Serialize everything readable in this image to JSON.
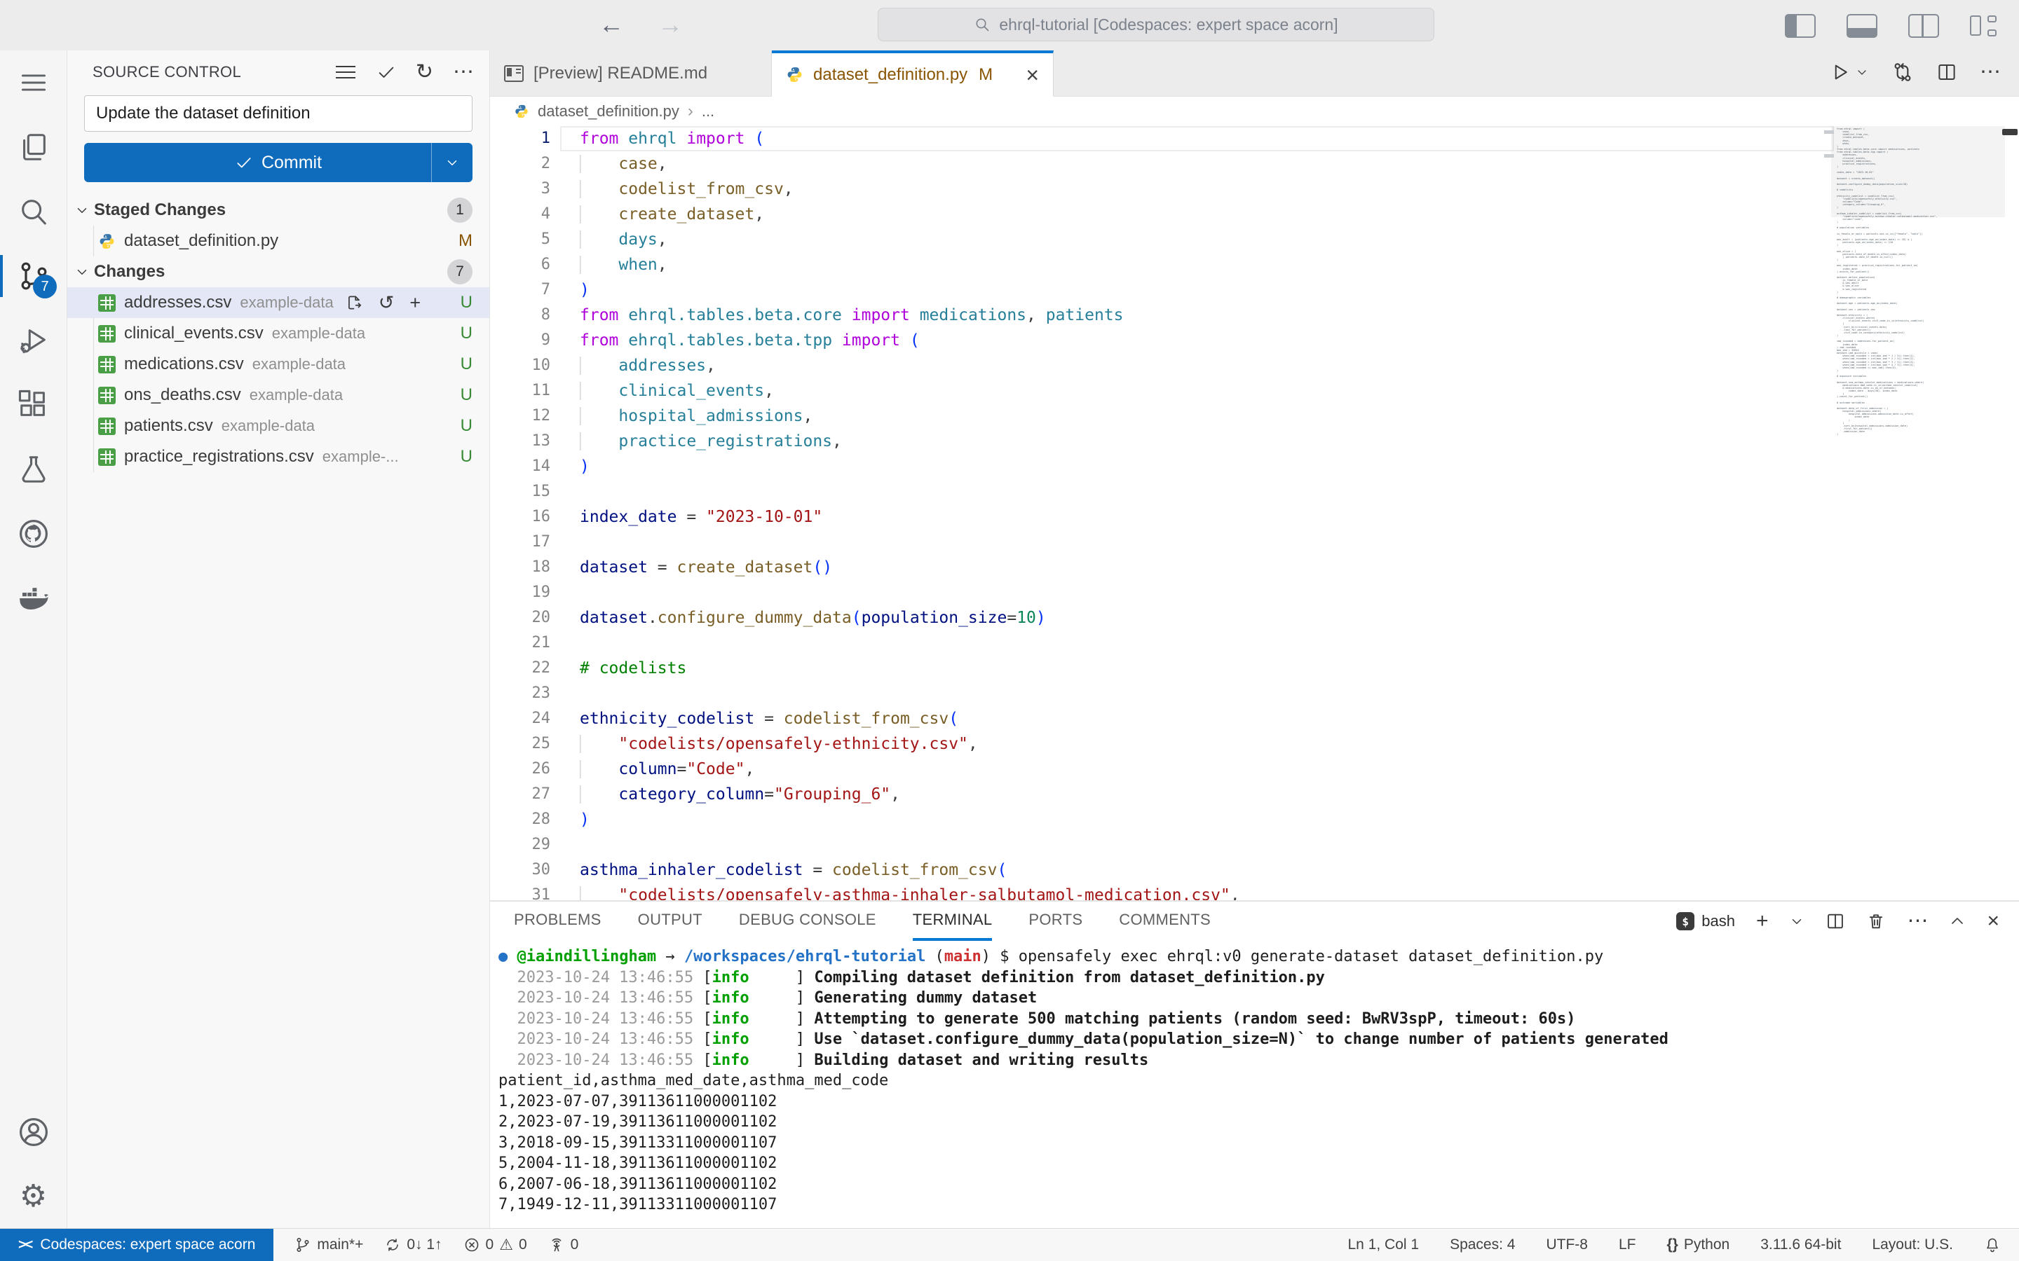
{
  "title_bar": {
    "search_text": "ehrql-tutorial [Codespaces: expert space acorn]"
  },
  "activity_bar": {
    "scm_badge": "7"
  },
  "sidebar": {
    "title": "SOURCE CONTROL",
    "commit_message": "Update the dataset definition",
    "commit_label": "Commit",
    "sections": [
      {
        "label": "Staged Changes",
        "badge": "1",
        "items": [
          {
            "name": "dataset_definition.py",
            "folder": "",
            "status": "M",
            "icon": "python",
            "hovered": false
          }
        ]
      },
      {
        "label": "Changes",
        "badge": "7",
        "items": [
          {
            "name": "addresses.csv",
            "folder": "example-data",
            "status": "U",
            "icon": "csv",
            "hovered": true
          },
          {
            "name": "clinical_events.csv",
            "folder": "example-data",
            "status": "U",
            "icon": "csv",
            "hovered": false
          },
          {
            "name": "medications.csv",
            "folder": "example-data",
            "status": "U",
            "icon": "csv",
            "hovered": false
          },
          {
            "name": "ons_deaths.csv",
            "folder": "example-data",
            "status": "U",
            "icon": "csv",
            "hovered": false
          },
          {
            "name": "patients.csv",
            "folder": "example-data",
            "status": "U",
            "icon": "csv",
            "hovered": false
          },
          {
            "name": "practice_registrations.csv",
            "folder": "example-...",
            "status": "U",
            "icon": "csv",
            "hovered": false
          }
        ]
      }
    ]
  },
  "editor": {
    "tabs": [
      {
        "label": "[Preview] README.md",
        "icon": "preview",
        "active": false,
        "badge": ""
      },
      {
        "label": "dataset_definition.py",
        "icon": "python",
        "active": true,
        "badge": "M"
      }
    ],
    "breadcrumb_file": "dataset_definition.py",
    "breadcrumb_more": "...",
    "code_lines": [
      {
        "n": 1,
        "cur": true,
        "t": [
          [
            "from",
            "k"
          ],
          [
            " ",
            "d"
          ],
          [
            "ehrql",
            "m"
          ],
          [
            " ",
            "d"
          ],
          [
            "import",
            "k"
          ],
          [
            " ",
            "d"
          ],
          [
            "(",
            "p"
          ]
        ]
      },
      {
        "n": 2,
        "t": [
          [
            "    ",
            "g"
          ],
          [
            "case",
            "f"
          ],
          [
            ",",
            "d"
          ]
        ]
      },
      {
        "n": 3,
        "t": [
          [
            "    ",
            "g"
          ],
          [
            "codelist_from_csv",
            "f"
          ],
          [
            ",",
            "d"
          ]
        ]
      },
      {
        "n": 4,
        "t": [
          [
            "    ",
            "g"
          ],
          [
            "create_dataset",
            "f"
          ],
          [
            ",",
            "d"
          ]
        ]
      },
      {
        "n": 5,
        "t": [
          [
            "    ",
            "g"
          ],
          [
            "days",
            "m"
          ],
          [
            ",",
            "d"
          ]
        ]
      },
      {
        "n": 6,
        "t": [
          [
            "    ",
            "g"
          ],
          [
            "when",
            "m"
          ],
          [
            ",",
            "d"
          ]
        ]
      },
      {
        "n": 7,
        "t": [
          [
            ")",
            "p"
          ]
        ]
      },
      {
        "n": 8,
        "t": [
          [
            "from",
            "k"
          ],
          [
            " ",
            "d"
          ],
          [
            "ehrql.tables.beta.core",
            "m"
          ],
          [
            " ",
            "d"
          ],
          [
            "import",
            "k"
          ],
          [
            " ",
            "d"
          ],
          [
            "medications",
            "m"
          ],
          [
            ", ",
            "d"
          ],
          [
            "patients",
            "m"
          ]
        ]
      },
      {
        "n": 9,
        "t": [
          [
            "from",
            "k"
          ],
          [
            " ",
            "d"
          ],
          [
            "ehrql.tables.beta.tpp",
            "m"
          ],
          [
            " ",
            "d"
          ],
          [
            "import",
            "k"
          ],
          [
            " ",
            "d"
          ],
          [
            "(",
            "p"
          ]
        ]
      },
      {
        "n": 10,
        "t": [
          [
            "    ",
            "g"
          ],
          [
            "addresses",
            "m"
          ],
          [
            ",",
            "d"
          ]
        ]
      },
      {
        "n": 11,
        "t": [
          [
            "    ",
            "g"
          ],
          [
            "clinical_events",
            "m"
          ],
          [
            ",",
            "d"
          ]
        ]
      },
      {
        "n": 12,
        "t": [
          [
            "    ",
            "g"
          ],
          [
            "hospital_admissions",
            "m"
          ],
          [
            ",",
            "d"
          ]
        ]
      },
      {
        "n": 13,
        "t": [
          [
            "    ",
            "g"
          ],
          [
            "practice_registrations",
            "m"
          ],
          [
            ",",
            "d"
          ]
        ]
      },
      {
        "n": 14,
        "t": [
          [
            ")",
            "p"
          ]
        ]
      },
      {
        "n": 15,
        "t": []
      },
      {
        "n": 16,
        "t": [
          [
            "index_date",
            "v"
          ],
          [
            " = ",
            "d"
          ],
          [
            "\"2023-10-01\"",
            "s"
          ]
        ]
      },
      {
        "n": 17,
        "t": []
      },
      {
        "n": 18,
        "t": [
          [
            "dataset",
            "v"
          ],
          [
            " = ",
            "d"
          ],
          [
            "create_dataset",
            "f"
          ],
          [
            "()",
            "p"
          ]
        ]
      },
      {
        "n": 19,
        "t": []
      },
      {
        "n": 20,
        "t": [
          [
            "dataset",
            "v"
          ],
          [
            ".",
            "d"
          ],
          [
            "configure_dummy_data",
            "f"
          ],
          [
            "(",
            "p"
          ],
          [
            "population_size",
            "v"
          ],
          [
            "=",
            "d"
          ],
          [
            "10",
            "n"
          ],
          [
            ")",
            "p"
          ]
        ]
      },
      {
        "n": 21,
        "t": []
      },
      {
        "n": 22,
        "t": [
          [
            "# codelists",
            "c"
          ]
        ]
      },
      {
        "n": 23,
        "t": []
      },
      {
        "n": 24,
        "t": [
          [
            "ethnicity_codelist",
            "v"
          ],
          [
            " = ",
            "d"
          ],
          [
            "codelist_from_csv",
            "f"
          ],
          [
            "(",
            "p"
          ]
        ]
      },
      {
        "n": 25,
        "t": [
          [
            "    ",
            "g"
          ],
          [
            "\"codelists/opensafely-ethnicity.csv\"",
            "s"
          ],
          [
            ",",
            "d"
          ]
        ]
      },
      {
        "n": 26,
        "t": [
          [
            "    ",
            "g"
          ],
          [
            "column",
            "v"
          ],
          [
            "=",
            "d"
          ],
          [
            "\"Code\"",
            "s"
          ],
          [
            ",",
            "d"
          ]
        ]
      },
      {
        "n": 27,
        "t": [
          [
            "    ",
            "g"
          ],
          [
            "category_column",
            "v"
          ],
          [
            "=",
            "d"
          ],
          [
            "\"Grouping_6\"",
            "s"
          ],
          [
            ",",
            "d"
          ]
        ]
      },
      {
        "n": 28,
        "t": [
          [
            ")",
            "p"
          ]
        ]
      },
      {
        "n": 29,
        "t": []
      },
      {
        "n": 30,
        "t": [
          [
            "asthma_inhaler_codelist",
            "v"
          ],
          [
            " = ",
            "d"
          ],
          [
            "codelist_from_csv",
            "f"
          ],
          [
            "(",
            "p"
          ]
        ]
      },
      {
        "n": 31,
        "t": [
          [
            "    ",
            "g"
          ],
          [
            "\"codelists/opensafely-asthma-inhaler-salbutamol-medication.csv\"",
            "s"
          ],
          [
            ",",
            "d"
          ]
        ]
      }
    ],
    "minimap_lines": [
      "from ehrql import (",
      "    case,",
      "    codelist_from_csv,",
      "    create_dataset,",
      "    days,",
      "    when,",
      ")",
      "from ehrql.tables.beta.core import medications, patients",
      "from ehrql.tables.beta.tpp import (",
      "    addresses,",
      "    clinical_events,",
      "    hospital_admissions,",
      "    practice_registrations,",
      ")",
      "",
      "index_date = \"2023-10-01\"",
      "",
      "dataset = create_dataset()",
      "",
      "dataset.configure_dummy_data(population_size=10)",
      "",
      "# codelists",
      "",
      "ethnicity_codelist = codelist_from_csv(",
      "    \"codelists/opensafely-ethnicity.csv\",",
      "    column=\"Code\",",
      "    category_column=\"Grouping_6\",",
      ")",
      "",
      "asthma_inhaler_codelist = codelist_from_csv(",
      "    \"codelists/opensafely-asthma-inhaler-salbutamol-medication.csv\",",
      "    column=\"code\",",
      ")",
      "",
      "# population variables",
      "",
      "is_female_or_male = patients.sex.is_in([\"female\", \"male\"])",
      "",
      "was_adult = (patients.age_on(index_date) >= 18) & (",
      "    patients.age_on(index_date) <= 110",
      ")",
      "",
      "was_alive = (",
      "    patients.date_of_death.is_after(index_date)",
      "    | patients.date_of_death.is_null()",
      ")",
      "",
      "was_registered = practice_registrations.for_patient_on(",
      "    index_date",
      ").exists_for_patient()",
      "",
      "dataset.define_population(",
      "    is_female_or_male",
      "    & was_adult",
      "    & was_alive",
      "    & was_registered",
      ")",
      "",
      "# demographic variables",
      "",
      "dataset.age = patients.age_on(index_date)",
      "",
      "dataset.sex = patients.sex",
      "",
      "dataset.ethnicity = (",
      "    clinical_events.where(",
      "        clinical_events.ctv3_code.is_in(ethnicity_codelist)",
      "    )",
      "    .sort_by(clinical_events.date)",
      "    .last_for_patient()",
      "    .ctv3_code.to_category(ethnicity_codelist)",
      ")",
      "",
      "imd_rounded = addresses.for_patient_on(",
      "    index_date",
      ").imd_rounded",
      "max_imd = 32844",
      "dataset.imd_quintile = case(",
      "    when(imd_rounded < int(max_imd * 1 / 5)).then(1),",
      "    when(imd_rounded < int(max_imd * 2 / 5)).then(2),",
      "    when(imd_rounded < int(max_imd * 3 / 5)).then(3),",
      "    when(imd_rounded < int(max_imd * 4 / 5)).then(4),",
      "    when(imd_rounded <= max_imd).then(5),",
      ")",
      "",
      "# exposure variables",
      "",
      "dataset.num_asthma_inhaler_medications = medications.where(",
      "    medications.dmd_code.is_in(asthma_inhaler_codelist)",
      "    & medications.date.is_on_or_between(",
      "        index_date - days(30), index_date",
      "    )",
      ").count_for_patient()",
      "",
      "# outcome variables",
      "",
      "dataset.date_of_first_admission = (",
      "    hospital_admissions.where(",
      "        hospital_admissions.admission_date.is_after(",
      "            index_date",
      "        )",
      "    )",
      "    .sort_by(hospital_admissions.admission_date)",
      "    .first_for_patient()",
      "    .admission_date",
      ")"
    ]
  },
  "panel": {
    "tabs": [
      {
        "label": "PROBLEMS",
        "active": false
      },
      {
        "label": "OUTPUT",
        "active": false
      },
      {
        "label": "DEBUG CONSOLE",
        "active": false
      },
      {
        "label": "TERMINAL",
        "active": true
      },
      {
        "label": "PORTS",
        "active": false
      },
      {
        "label": "COMMENTS",
        "active": false
      }
    ],
    "shell_label": "bash",
    "terminal_lines": [
      [
        [
          "● ",
          "t-dot"
        ],
        [
          "@iaindillingham",
          "t-g"
        ],
        [
          " → ",
          "t-d"
        ],
        [
          "/workspaces/ehrql-tutorial",
          "t-b"
        ],
        [
          " (",
          "t-d"
        ],
        [
          "main",
          "t-r"
        ],
        [
          ") ",
          "t-d"
        ],
        [
          "$ opensafely exec ehrql:v0 generate-dataset dataset_definition.py",
          "t-d"
        ]
      ],
      [
        [
          "  2023-10-24 13:46:55 ",
          "t-dim"
        ],
        [
          "[",
          "t-d"
        ],
        [
          "info",
          "t-g"
        ],
        [
          "     ] ",
          "t-d"
        ],
        [
          "Compiling dataset definition from dataset_definition.py",
          "t-bold"
        ]
      ],
      [
        [
          "  2023-10-24 13:46:55 ",
          "t-dim"
        ],
        [
          "[",
          "t-d"
        ],
        [
          "info",
          "t-g"
        ],
        [
          "     ] ",
          "t-d"
        ],
        [
          "Generating dummy dataset",
          "t-bold"
        ]
      ],
      [
        [
          "  2023-10-24 13:46:55 ",
          "t-dim"
        ],
        [
          "[",
          "t-d"
        ],
        [
          "info",
          "t-g"
        ],
        [
          "     ] ",
          "t-d"
        ],
        [
          "Attempting to generate 500 matching patients (random seed: BwRV3spP, timeout: 60s)",
          "t-bold"
        ]
      ],
      [
        [
          "  2023-10-24 13:46:55 ",
          "t-dim"
        ],
        [
          "[",
          "t-d"
        ],
        [
          "info",
          "t-g"
        ],
        [
          "     ] ",
          "t-d"
        ],
        [
          "Use `dataset.configure_dummy_data(population_size=N)` to change number of patients generated",
          "t-bold"
        ]
      ],
      [
        [
          "  2023-10-24 13:46:55 ",
          "t-dim"
        ],
        [
          "[",
          "t-d"
        ],
        [
          "info",
          "t-g"
        ],
        [
          "     ] ",
          "t-d"
        ],
        [
          "Building dataset and writing results",
          "t-bold"
        ]
      ],
      [
        [
          "patient_id,asthma_med_date,asthma_med_code",
          "t-d"
        ]
      ],
      [
        [
          "1,2023-07-07,39113611000001102",
          "t-d"
        ]
      ],
      [
        [
          "2,2023-07-19,39113611000001102",
          "t-d"
        ]
      ],
      [
        [
          "3,2018-09-15,39113311000001107",
          "t-d"
        ]
      ],
      [
        [
          "5,2004-11-18,39113611000001102",
          "t-d"
        ]
      ],
      [
        [
          "6,2007-06-18,39113611000001102",
          "t-d"
        ]
      ],
      [
        [
          "7,1949-12-11,39113311000001107",
          "t-d"
        ]
      ]
    ]
  },
  "status_bar": {
    "remote_label": "Codespaces: expert space acorn",
    "branch": "main*+",
    "sync": "0↓ 1↑",
    "errors": "0",
    "warnings": "0",
    "ports": "0",
    "cursor": "Ln 1, Col 1",
    "indent": "Spaces: 4",
    "encoding": "UTF-8",
    "eol": "LF",
    "lang_icon": "{}",
    "language": "Python",
    "runtime": "3.11.6 64-bit",
    "layout": "Layout: U.S."
  }
}
